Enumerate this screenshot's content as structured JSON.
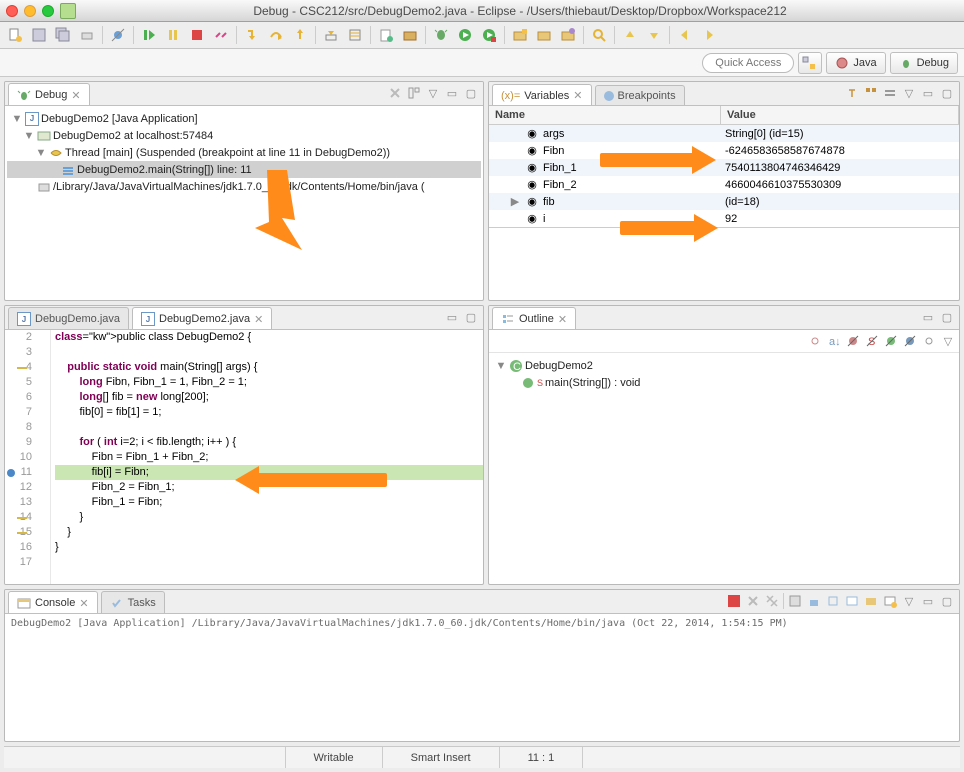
{
  "window": {
    "title": "Debug - CSC212/src/DebugDemo2.java - Eclipse - /Users/thiebaut/Desktop/Dropbox/Workspace212"
  },
  "perspectives": {
    "quick_access": "Quick Access",
    "java": "Java",
    "debug": "Debug"
  },
  "debug_view": {
    "tab": "Debug",
    "items": [
      {
        "lvl": 0,
        "twist": "▼",
        "icon": "app",
        "text": "DebugDemo2 [Java Application]"
      },
      {
        "lvl": 1,
        "twist": "▼",
        "icon": "vm",
        "text": "DebugDemo2 at localhost:57484"
      },
      {
        "lvl": 2,
        "twist": "▼",
        "icon": "thread",
        "text": "Thread [main] (Suspended (breakpoint at line 11 in DebugDemo2))"
      },
      {
        "lvl": 3,
        "twist": "",
        "icon": "frame",
        "text": "DebugDemo2.main(String[]) line: 11",
        "sel": true
      },
      {
        "lvl": 1,
        "twist": "",
        "icon": "proc",
        "text": "/Library/Java/JavaVirtualMachines/jdk1.7.0_60.jdk/Contents/Home/bin/java ("
      }
    ]
  },
  "vars_view": {
    "tab_vars": "Variables",
    "tab_bp": "Breakpoints",
    "col_name": "Name",
    "col_value": "Value",
    "rows": [
      {
        "name": "args",
        "value": "String[0]  (id=15)",
        "tw": ""
      },
      {
        "name": "Fibn",
        "value": "-6246583658587674878",
        "tw": ""
      },
      {
        "name": "Fibn_1",
        "value": "7540113804746346429",
        "tw": ""
      },
      {
        "name": "Fibn_2",
        "value": "4660046610375530309",
        "tw": ""
      },
      {
        "name": "fib",
        "value": "(id=18)",
        "tw": "▶"
      },
      {
        "name": "i",
        "value": "92",
        "tw": ""
      }
    ]
  },
  "editor": {
    "tab1": "DebugDemo.java",
    "tab2": "DebugDemo2.java",
    "lines": [
      {
        "n": 2,
        "t": "public class DebugDemo2 {",
        "kw": [
          "public",
          "class"
        ]
      },
      {
        "n": 3,
        "t": ""
      },
      {
        "n": 4,
        "t": "    public static void main(String[] args) {",
        "kw": [
          "public",
          "static",
          "void"
        ],
        "warn": true
      },
      {
        "n": 5,
        "t": "        long Fibn, Fibn_1 = 1, Fibn_2 = 1;",
        "kw": [
          "long"
        ]
      },
      {
        "n": 6,
        "t": "        long[] fib = new long[200];",
        "kw": [
          "long",
          "new",
          "long"
        ]
      },
      {
        "n": 7,
        "t": "        fib[0] = fib[1] = 1;"
      },
      {
        "n": 8,
        "t": ""
      },
      {
        "n": 9,
        "t": "        for ( int i=2; i < fib.length; i++ ) {",
        "kw": [
          "for",
          "int"
        ]
      },
      {
        "n": 10,
        "t": "            Fibn = Fibn_1 + Fibn_2;"
      },
      {
        "n": 11,
        "t": "            fib[i] = Fibn;",
        "bp": true
      },
      {
        "n": 12,
        "t": "            Fibn_2 = Fibn_1;"
      },
      {
        "n": 13,
        "t": "            Fibn_1 = Fibn;"
      },
      {
        "n": 14,
        "t": "        }",
        "warn": true
      },
      {
        "n": 15,
        "t": "    }",
        "warn": true
      },
      {
        "n": 16,
        "t": "}"
      },
      {
        "n": 17,
        "t": ""
      }
    ]
  },
  "outline": {
    "tab": "Outline",
    "items": [
      {
        "lvl": 0,
        "tw": "▼",
        "ic": "class",
        "text": "DebugDemo2"
      },
      {
        "lvl": 1,
        "tw": "",
        "ic": "method",
        "text": "main(String[]) : void",
        "prefix": "S "
      }
    ]
  },
  "console": {
    "tab_console": "Console",
    "tab_tasks": "Tasks",
    "text": "DebugDemo2 [Java Application] /Library/Java/JavaVirtualMachines/jdk1.7.0_60.jdk/Contents/Home/bin/java (Oct 22, 2014, 1:54:15 PM)"
  },
  "status": {
    "writable": "Writable",
    "insert": "Smart Insert",
    "pos": "11 : 1"
  }
}
